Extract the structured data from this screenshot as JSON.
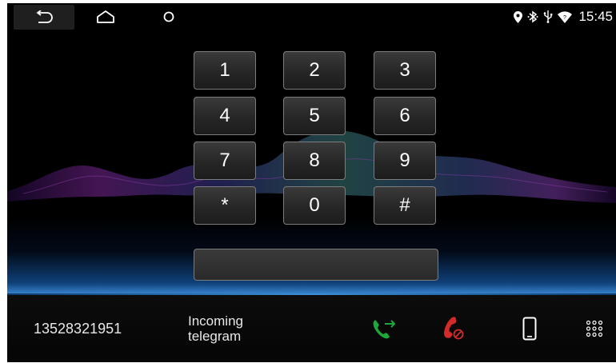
{
  "status_bar": {
    "time": "15:45",
    "icons": [
      "location-icon",
      "bluetooth-icon",
      "usb-icon",
      "wifi-icon"
    ]
  },
  "nav": {
    "icons": [
      "back-icon",
      "home-icon",
      "recent-apps-icon"
    ]
  },
  "keypad": {
    "keys": [
      "1",
      "2",
      "3",
      "4",
      "5",
      "6",
      "7",
      "8",
      "9",
      "*",
      "0",
      "#"
    ],
    "number_field_value": ""
  },
  "call": {
    "number": "13528321951",
    "status_line1": "Incoming",
    "status_line2": "telegram"
  },
  "actions": {
    "icons": [
      "answer-call-icon",
      "reject-call-icon",
      "phone-device-icon",
      "dialpad-grid-icon"
    ],
    "answer_color": "#1fa83a",
    "reject_color": "#d42a2a"
  }
}
